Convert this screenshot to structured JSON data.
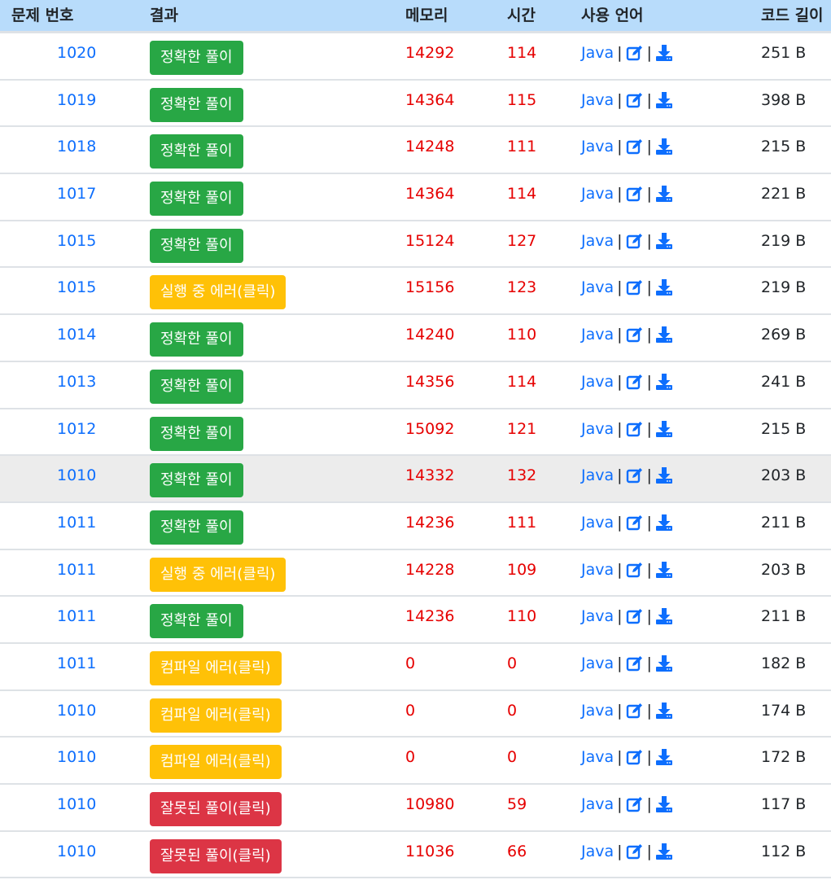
{
  "headers": [
    "문제 번호",
    "결과",
    "메모리",
    "시간",
    "사용 언어",
    "코드 길이"
  ],
  "colors": {
    "green": "#28a745",
    "yellow": "#ffc107",
    "red": "#dc3545",
    "link": "#0d6efd",
    "value": "#e60000",
    "header_bg": "#b8dcfb"
  },
  "icons": {
    "edit": "edit-icon",
    "download": "download-icon"
  },
  "rows": [
    {
      "problem": "1020",
      "result": "정확한 풀이",
      "status": "green",
      "memory": "14292",
      "time": "114",
      "lang": "Java",
      "length": "251 B"
    },
    {
      "problem": "1019",
      "result": "정확한 풀이",
      "status": "green",
      "memory": "14364",
      "time": "115",
      "lang": "Java",
      "length": "398 B"
    },
    {
      "problem": "1018",
      "result": "정확한 풀이",
      "status": "green",
      "memory": "14248",
      "time": "111",
      "lang": "Java",
      "length": "215 B"
    },
    {
      "problem": "1017",
      "result": "정확한 풀이",
      "status": "green",
      "memory": "14364",
      "time": "114",
      "lang": "Java",
      "length": "221 B"
    },
    {
      "problem": "1015",
      "result": "정확한 풀이",
      "status": "green",
      "memory": "15124",
      "time": "127",
      "lang": "Java",
      "length": "219 B"
    },
    {
      "problem": "1015",
      "result": "실행 중 에러(클릭)",
      "status": "yellow",
      "memory": "15156",
      "time": "123",
      "lang": "Java",
      "length": "219 B"
    },
    {
      "problem": "1014",
      "result": "정확한 풀이",
      "status": "green",
      "memory": "14240",
      "time": "110",
      "lang": "Java",
      "length": "269 B"
    },
    {
      "problem": "1013",
      "result": "정확한 풀이",
      "status": "green",
      "memory": "14356",
      "time": "114",
      "lang": "Java",
      "length": "241 B"
    },
    {
      "problem": "1012",
      "result": "정확한 풀이",
      "status": "green",
      "memory": "15092",
      "time": "121",
      "lang": "Java",
      "length": "215 B"
    },
    {
      "problem": "1010",
      "result": "정확한 풀이",
      "status": "green",
      "memory": "14332",
      "time": "132",
      "lang": "Java",
      "length": "203 B",
      "highlight": true
    },
    {
      "problem": "1011",
      "result": "정확한 풀이",
      "status": "green",
      "memory": "14236",
      "time": "111",
      "lang": "Java",
      "length": "211 B"
    },
    {
      "problem": "1011",
      "result": "실행 중 에러(클릭)",
      "status": "yellow",
      "memory": "14228",
      "time": "109",
      "lang": "Java",
      "length": "203 B"
    },
    {
      "problem": "1011",
      "result": "정확한 풀이",
      "status": "green",
      "memory": "14236",
      "time": "110",
      "lang": "Java",
      "length": "211 B"
    },
    {
      "problem": "1011",
      "result": "컴파일 에러(클릭)",
      "status": "yellow",
      "memory": "0",
      "time": "0",
      "lang": "Java",
      "length": "182 B"
    },
    {
      "problem": "1010",
      "result": "컴파일 에러(클릭)",
      "status": "yellow",
      "memory": "0",
      "time": "0",
      "lang": "Java",
      "length": "174 B"
    },
    {
      "problem": "1010",
      "result": "컴파일 에러(클릭)",
      "status": "yellow",
      "memory": "0",
      "time": "0",
      "lang": "Java",
      "length": "172 B"
    },
    {
      "problem": "1010",
      "result": "잘못된 풀이(클릭)",
      "status": "red",
      "memory": "10980",
      "time": "59",
      "lang": "Java",
      "length": "117 B"
    },
    {
      "problem": "1010",
      "result": "잘못된 풀이(클릭)",
      "status": "red",
      "memory": "11036",
      "time": "66",
      "lang": "Java",
      "length": "112 B"
    }
  ]
}
